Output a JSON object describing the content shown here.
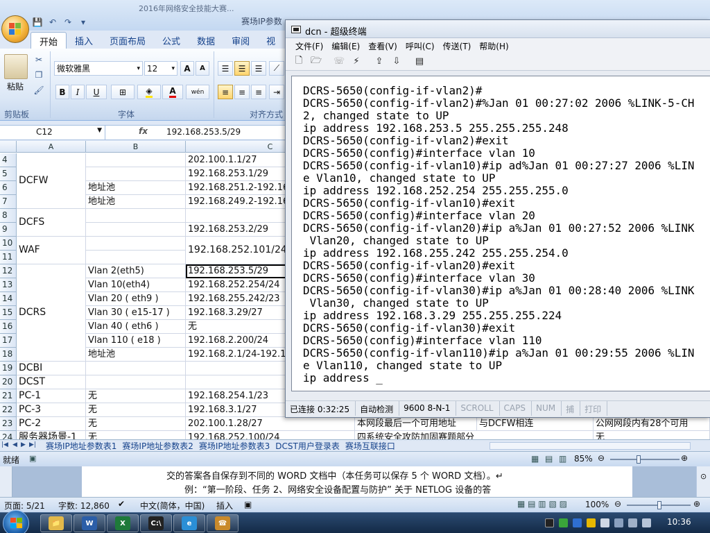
{
  "excel": {
    "title_faded": "2016年网络安全技能大赛...",
    "title_visible": "赛场IP参数",
    "quick_access": {
      "save_glyph": "💾",
      "undo_glyph": "↶",
      "redo_glyph": "↷",
      "dropdown_glyph": "▾"
    },
    "tabs": [
      "开始",
      "插入",
      "页面布局",
      "公式",
      "数据",
      "审阅",
      "视"
    ],
    "ribbon": {
      "paste_label": "粘贴",
      "clipboard_label": "剪贴板",
      "font_name": "微软雅黑",
      "font_size": "12",
      "grow_font": "A",
      "shrink_font": "A",
      "bold": "B",
      "italic": "I",
      "underline": "U",
      "font_color": "A",
      "phonetic": "wén",
      "font_group_label": "字体",
      "align_group_label": "对齐方式"
    },
    "name_box": "C12",
    "fx_label": "fx",
    "formula": "192.168.253.5/29",
    "columns": [
      "A",
      "B",
      "C"
    ],
    "rows": [
      {
        "n": "4",
        "b": "",
        "c": "202.100.1.1/27"
      },
      {
        "n": "5",
        "b": "",
        "c": "192.168.253.1/29"
      },
      {
        "n": "6",
        "b": "地址池",
        "c": "192.168.251.2-192.168"
      },
      {
        "n": "7",
        "b": "地址池",
        "c": "192.168.249.2-192.168"
      },
      {
        "n": "8",
        "b": "",
        "c": ""
      },
      {
        "n": "9",
        "b": "",
        "c": "192.168.253.2/29"
      },
      {
        "n": "10",
        "b": "",
        "c": ""
      },
      {
        "n": "11",
        "b": "",
        "c": ""
      },
      {
        "n": "12",
        "b": "Vlan 2(eth5)",
        "c": "192.168.253.5/29"
      },
      {
        "n": "13",
        "b": "Vlan 10(eth4)",
        "c": "192.168.252.254/24"
      },
      {
        "n": "14",
        "b": "Vlan 20 ( eth9 )",
        "c": "192.168.255.242/23"
      },
      {
        "n": "15",
        "b": "Vlan 30 ( e15-17 )",
        "c": "192.168.3.29/27"
      },
      {
        "n": "16",
        "b": "Vlan 40 ( eth6 )",
        "c": "无"
      },
      {
        "n": "17",
        "b": "Vlan 110 ( e18 )",
        "c": "192.168.2.200/24"
      },
      {
        "n": "18",
        "b": "地址池",
        "c": "192.168.2.1/24-192.16"
      },
      {
        "n": "19",
        "b": "",
        "c": ""
      },
      {
        "n": "20",
        "b": "",
        "c": ""
      },
      {
        "n": "21",
        "b": "无",
        "c": "192.168.254.1/23"
      },
      {
        "n": "22",
        "b": "无",
        "c": "192.168.3.1/27"
      },
      {
        "n": "23",
        "b": "无",
        "c": "202.100.1.28/27"
      },
      {
        "n": "24",
        "b": "无",
        "c": "192.168.252.100/24"
      }
    ],
    "merged_a": [
      {
        "label": "DCFW"
      },
      {
        "label": "DCFS"
      },
      {
        "label": "WAF"
      },
      {
        "label": "DCRS"
      },
      {
        "label": "DCBI"
      },
      {
        "label": "DCST"
      },
      {
        "label": "PC-1"
      },
      {
        "label": "PC-3"
      },
      {
        "label": "PC-2"
      },
      {
        "label": "服务器场景-1"
      }
    ],
    "waf_c": "192.168.252.101/24",
    "overflow_row23": [
      "本网段最后一个可用地址",
      "与DCFW相连",
      "公网网段内有28个可用"
    ],
    "overflow_row24": [
      "四系统安全攻防加固赛题部分",
      "无"
    ],
    "sheet_tabs": [
      "赛场IP地址参数表1",
      "赛场IP地址参数表2",
      "赛场IP地址参数表3",
      "DCST用户登录表",
      "赛场互联接口"
    ],
    "status_ready": "就绪",
    "zoom": "85%"
  },
  "word": {
    "line1": "交的答案各自保存到不同的 WORD 文档中（本任务可以保存 5 个 WORD 文档）。↵",
    "line2": "例：“第一阶段、任务 2、网络安全设备配置与防护” 关于 NETLOG 设备的答",
    "status": {
      "page": "页面: 5/21",
      "words": "字数: 12,860",
      "lang": "中文(简体，中国)",
      "mode": "插入",
      "zoom": "100%"
    }
  },
  "terminal": {
    "title": "dcn - 超级终端",
    "menu": [
      "文件(F)",
      "编辑(E)",
      "查看(V)",
      "呼叫(C)",
      "传送(T)",
      "帮助(H)"
    ],
    "output": "DCRS-5650(config-if-vlan2)#\nDCRS-5650(config-if-vlan2)#%Jan 01 00:27:02 2006 %LINK-5-CH\n2, changed state to UP\nip address 192.168.253.5 255.255.255.248\nDCRS-5650(config-if-vlan2)#exit\nDCRS-5650(config)#interface vlan 10\nDCRS-5650(config-if-vlan10)#ip ad%Jan 01 00:27:27 2006 %LIN\ne Vlan10, changed state to UP\nip address 192.168.252.254 255.255.255.0\nDCRS-5650(config-if-vlan10)#exit\nDCRS-5650(config)#interface vlan 20\nDCRS-5650(config-if-vlan20)#ip a%Jan 01 00:27:52 2006 %LINK\n Vlan20, changed state to UP\nip address 192.168.255.242 255.255.254.0\nDCRS-5650(config-if-vlan20)#exit\nDCRS-5650(config)#interface vlan 30\nDCRS-5650(config-if-vlan30)#ip a%Jan 01 00:28:40 2006 %LINK\n Vlan30, changed state to UP\nip address 192.168.3.29 255.255.255.224\nDCRS-5650(config-if-vlan30)#exit\nDCRS-5650(config)#interface vlan 110\nDCRS-5650(config-if-vlan110)#ip a%Jan 01 00:29:55 2006 %LIN\ne Vlan110, changed state to UP\nip address _",
    "status": [
      "已连接 0:32:25",
      "自动检测",
      "9600 8-N-1",
      "SCROLL",
      "CAPS",
      "NUM",
      "捕",
      "打印"
    ]
  },
  "taskbar": {
    "clock": "10:36",
    "apps": [
      {
        "name": "explorer",
        "glyph": "📁",
        "color": "#e3b94a"
      },
      {
        "name": "word",
        "glyph": "W",
        "color": "#2b5ea8"
      },
      {
        "name": "excel",
        "glyph": "X",
        "color": "#1e7a3a"
      },
      {
        "name": "cmd",
        "glyph": "C:\\",
        "color": "#222222"
      },
      {
        "name": "ie",
        "glyph": "e",
        "color": "#2b8fd6"
      },
      {
        "name": "hyperterminal",
        "glyph": "☎",
        "color": "#c98a2b"
      }
    ]
  },
  "colors": {
    "excel_ribbon_blue": "#dbe7f6",
    "terminal_bg": "#ffffff",
    "taskbar": "#1c3a5e"
  }
}
